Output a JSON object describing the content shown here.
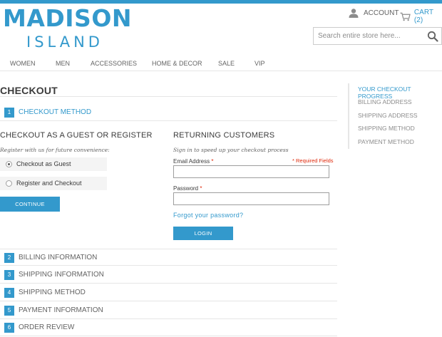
{
  "header": {
    "logo_main": "MADISON",
    "logo_sub": "ISLAND",
    "account_label": "ACCOUNT",
    "cart_label": "CART (2)",
    "search_placeholder": "Search entire store here..."
  },
  "nav": {
    "items": [
      "WOMEN",
      "MEN",
      "ACCESSORIES",
      "HOME & DECOR",
      "SALE",
      "VIP"
    ]
  },
  "checkout": {
    "page_title": "CHECKOUT",
    "steps": [
      {
        "num": "1",
        "label": "CHECKOUT METHOD",
        "active": true
      },
      {
        "num": "2",
        "label": "BILLING INFORMATION"
      },
      {
        "num": "3",
        "label": "SHIPPING INFORMATION"
      },
      {
        "num": "4",
        "label": "SHIPPING METHOD"
      },
      {
        "num": "5",
        "label": "PAYMENT INFORMATION"
      },
      {
        "num": "6",
        "label": "ORDER REVIEW"
      }
    ],
    "guest": {
      "heading": "CHECKOUT AS A GUEST OR REGISTER",
      "subtext": "Register with us for future convenience:",
      "options": [
        {
          "label": "Checkout as Guest",
          "selected": true
        },
        {
          "label": "Register and Checkout",
          "selected": false
        }
      ],
      "continue_label": "CONTINUE"
    },
    "returning": {
      "heading": "RETURNING CUSTOMERS",
      "subtext": "Sign in to speed up your checkout process",
      "required_note": "* Required Fields",
      "email_label": "Email Address",
      "password_label": "Password",
      "required_mark": "*",
      "email_value": "",
      "password_value": "",
      "forgot_label": "Forgot your password?",
      "login_label": "LOGIN"
    }
  },
  "progress": {
    "title": "YOUR CHECKOUT PROGRESS",
    "items": [
      "BILLING ADDRESS",
      "SHIPPING ADDRESS",
      "SHIPPING METHOD",
      "PAYMENT METHOD"
    ]
  },
  "colors": {
    "accent": "#3399cc",
    "required": "#df280a",
    "text": "#636363"
  }
}
